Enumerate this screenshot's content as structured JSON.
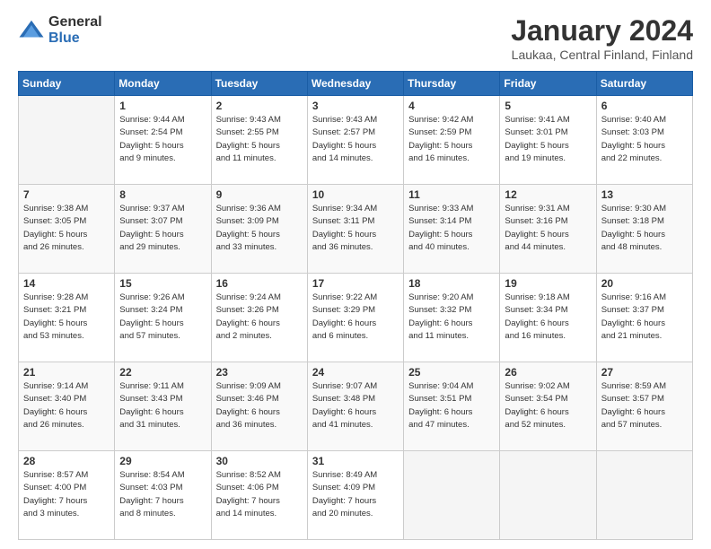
{
  "logo": {
    "general": "General",
    "blue": "Blue"
  },
  "title": "January 2024",
  "subtitle": "Laukaa, Central Finland, Finland",
  "days_header": [
    "Sunday",
    "Monday",
    "Tuesday",
    "Wednesday",
    "Thursday",
    "Friday",
    "Saturday"
  ],
  "weeks": [
    [
      {
        "day": "",
        "info": ""
      },
      {
        "day": "1",
        "info": "Sunrise: 9:44 AM\nSunset: 2:54 PM\nDaylight: 5 hours\nand 9 minutes."
      },
      {
        "day": "2",
        "info": "Sunrise: 9:43 AM\nSunset: 2:55 PM\nDaylight: 5 hours\nand 11 minutes."
      },
      {
        "day": "3",
        "info": "Sunrise: 9:43 AM\nSunset: 2:57 PM\nDaylight: 5 hours\nand 14 minutes."
      },
      {
        "day": "4",
        "info": "Sunrise: 9:42 AM\nSunset: 2:59 PM\nDaylight: 5 hours\nand 16 minutes."
      },
      {
        "day": "5",
        "info": "Sunrise: 9:41 AM\nSunset: 3:01 PM\nDaylight: 5 hours\nand 19 minutes."
      },
      {
        "day": "6",
        "info": "Sunrise: 9:40 AM\nSunset: 3:03 PM\nDaylight: 5 hours\nand 22 minutes."
      }
    ],
    [
      {
        "day": "7",
        "info": "Sunrise: 9:38 AM\nSunset: 3:05 PM\nDaylight: 5 hours\nand 26 minutes."
      },
      {
        "day": "8",
        "info": "Sunrise: 9:37 AM\nSunset: 3:07 PM\nDaylight: 5 hours\nand 29 minutes."
      },
      {
        "day": "9",
        "info": "Sunrise: 9:36 AM\nSunset: 3:09 PM\nDaylight: 5 hours\nand 33 minutes."
      },
      {
        "day": "10",
        "info": "Sunrise: 9:34 AM\nSunset: 3:11 PM\nDaylight: 5 hours\nand 36 minutes."
      },
      {
        "day": "11",
        "info": "Sunrise: 9:33 AM\nSunset: 3:14 PM\nDaylight: 5 hours\nand 40 minutes."
      },
      {
        "day": "12",
        "info": "Sunrise: 9:31 AM\nSunset: 3:16 PM\nDaylight: 5 hours\nand 44 minutes."
      },
      {
        "day": "13",
        "info": "Sunrise: 9:30 AM\nSunset: 3:18 PM\nDaylight: 5 hours\nand 48 minutes."
      }
    ],
    [
      {
        "day": "14",
        "info": "Sunrise: 9:28 AM\nSunset: 3:21 PM\nDaylight: 5 hours\nand 53 minutes."
      },
      {
        "day": "15",
        "info": "Sunrise: 9:26 AM\nSunset: 3:24 PM\nDaylight: 5 hours\nand 57 minutes."
      },
      {
        "day": "16",
        "info": "Sunrise: 9:24 AM\nSunset: 3:26 PM\nDaylight: 6 hours\nand 2 minutes."
      },
      {
        "day": "17",
        "info": "Sunrise: 9:22 AM\nSunset: 3:29 PM\nDaylight: 6 hours\nand 6 minutes."
      },
      {
        "day": "18",
        "info": "Sunrise: 9:20 AM\nSunset: 3:32 PM\nDaylight: 6 hours\nand 11 minutes."
      },
      {
        "day": "19",
        "info": "Sunrise: 9:18 AM\nSunset: 3:34 PM\nDaylight: 6 hours\nand 16 minutes."
      },
      {
        "day": "20",
        "info": "Sunrise: 9:16 AM\nSunset: 3:37 PM\nDaylight: 6 hours\nand 21 minutes."
      }
    ],
    [
      {
        "day": "21",
        "info": "Sunrise: 9:14 AM\nSunset: 3:40 PM\nDaylight: 6 hours\nand 26 minutes."
      },
      {
        "day": "22",
        "info": "Sunrise: 9:11 AM\nSunset: 3:43 PM\nDaylight: 6 hours\nand 31 minutes."
      },
      {
        "day": "23",
        "info": "Sunrise: 9:09 AM\nSunset: 3:46 PM\nDaylight: 6 hours\nand 36 minutes."
      },
      {
        "day": "24",
        "info": "Sunrise: 9:07 AM\nSunset: 3:48 PM\nDaylight: 6 hours\nand 41 minutes."
      },
      {
        "day": "25",
        "info": "Sunrise: 9:04 AM\nSunset: 3:51 PM\nDaylight: 6 hours\nand 47 minutes."
      },
      {
        "day": "26",
        "info": "Sunrise: 9:02 AM\nSunset: 3:54 PM\nDaylight: 6 hours\nand 52 minutes."
      },
      {
        "day": "27",
        "info": "Sunrise: 8:59 AM\nSunset: 3:57 PM\nDaylight: 6 hours\nand 57 minutes."
      }
    ],
    [
      {
        "day": "28",
        "info": "Sunrise: 8:57 AM\nSunset: 4:00 PM\nDaylight: 7 hours\nand 3 minutes."
      },
      {
        "day": "29",
        "info": "Sunrise: 8:54 AM\nSunset: 4:03 PM\nDaylight: 7 hours\nand 8 minutes."
      },
      {
        "day": "30",
        "info": "Sunrise: 8:52 AM\nSunset: 4:06 PM\nDaylight: 7 hours\nand 14 minutes."
      },
      {
        "day": "31",
        "info": "Sunrise: 8:49 AM\nSunset: 4:09 PM\nDaylight: 7 hours\nand 20 minutes."
      },
      {
        "day": "",
        "info": ""
      },
      {
        "day": "",
        "info": ""
      },
      {
        "day": "",
        "info": ""
      }
    ]
  ]
}
